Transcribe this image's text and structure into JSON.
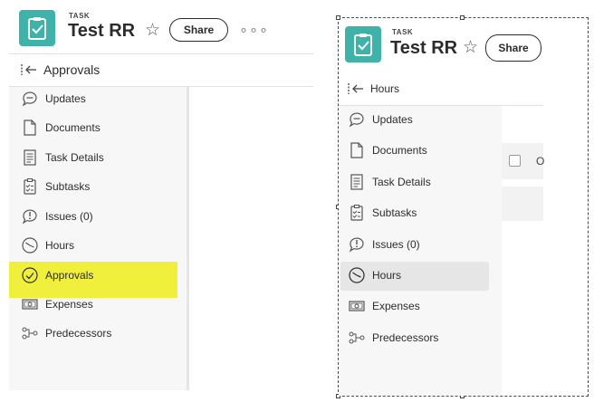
{
  "left": {
    "task_type": "TASK",
    "title": "Test RR",
    "share_label": "Share",
    "more_label": "∘∘∘",
    "current_section": "Approvals",
    "nav_items": [
      {
        "label": "Updates",
        "icon": "speech-bubble-icon"
      },
      {
        "label": "Documents",
        "icon": "document-icon"
      },
      {
        "label": "Task Details",
        "icon": "task-details-icon"
      },
      {
        "label": "Subtasks",
        "icon": "subtasks-icon"
      },
      {
        "label": "Issues (0)",
        "icon": "issue-icon"
      },
      {
        "label": "Hours",
        "icon": "clock-icon"
      },
      {
        "label": "Approvals",
        "icon": "approval-check-icon"
      },
      {
        "label": "Expenses",
        "icon": "expenses-icon"
      },
      {
        "label": "Predecessors",
        "icon": "predecessors-icon"
      }
    ],
    "highlighted_item": "Approvals"
  },
  "right": {
    "task_type": "TASK",
    "title": "Test RR",
    "share_label": "Share",
    "current_section": "Hours",
    "nav_items": [
      {
        "label": "Updates",
        "icon": "speech-bubble-icon"
      },
      {
        "label": "Documents",
        "icon": "document-icon"
      },
      {
        "label": "Task Details",
        "icon": "task-details-icon"
      },
      {
        "label": "Subtasks",
        "icon": "subtasks-icon"
      },
      {
        "label": "Issues (0)",
        "icon": "issue-icon"
      },
      {
        "label": "Hours",
        "icon": "clock-icon"
      },
      {
        "label": "Expenses",
        "icon": "expenses-icon"
      },
      {
        "label": "Predecessors",
        "icon": "predecessors-icon"
      }
    ],
    "active_item": "Hours",
    "column_stub": "O"
  },
  "colors": {
    "task_icon": "#3fb3aa",
    "highlight": "#f0f03c",
    "active_bg": "#e6e6e6",
    "nav_bg": "#f7f7f7"
  }
}
